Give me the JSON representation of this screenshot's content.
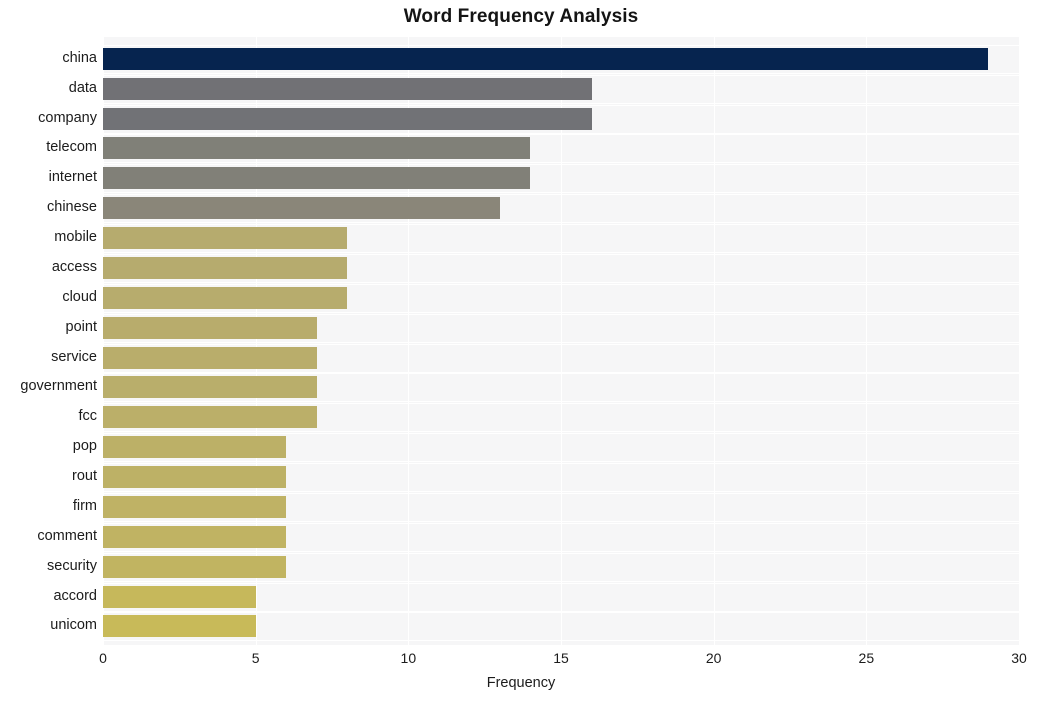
{
  "chart_data": {
    "type": "bar",
    "orientation": "horizontal",
    "title": "Word Frequency Analysis",
    "xlabel": "Frequency",
    "ylabel": "",
    "xlim": [
      0,
      30
    ],
    "xticks": [
      0,
      5,
      10,
      15,
      20,
      25,
      30
    ],
    "xtick_labels": [
      "0",
      "5",
      "10",
      "15",
      "20",
      "25",
      "30"
    ],
    "grid": true,
    "legend": null,
    "categories": [
      "china",
      "data",
      "company",
      "telecom",
      "internet",
      "chinese",
      "mobile",
      "access",
      "cloud",
      "point",
      "service",
      "government",
      "fcc",
      "pop",
      "rout",
      "firm",
      "comment",
      "security",
      "accord",
      "unicom"
    ],
    "values": [
      29,
      16,
      16,
      14,
      14,
      13,
      8,
      8,
      8,
      7,
      7,
      7,
      7,
      6,
      6,
      6,
      6,
      6,
      5,
      5
    ],
    "bar_colors": [
      "#06244f",
      "#717175",
      "#717276",
      "#808078",
      "#818078",
      "#8a8679",
      "#b6ab6e",
      "#b6ab6e",
      "#b7ac6d",
      "#b8ac6c",
      "#b9ad6b",
      "#b9ae6b",
      "#bbaf69",
      "#bcb067",
      "#bdb166",
      "#bfb265",
      "#c0b363",
      "#c1b461",
      "#c6b85b",
      "#c8ba59"
    ],
    "plot_background": "#f6f6f7",
    "figure_background": "#ffffff",
    "gridline_color": "#ffffff",
    "title_color": "#141414",
    "tick_color": "#1c1c1c"
  }
}
